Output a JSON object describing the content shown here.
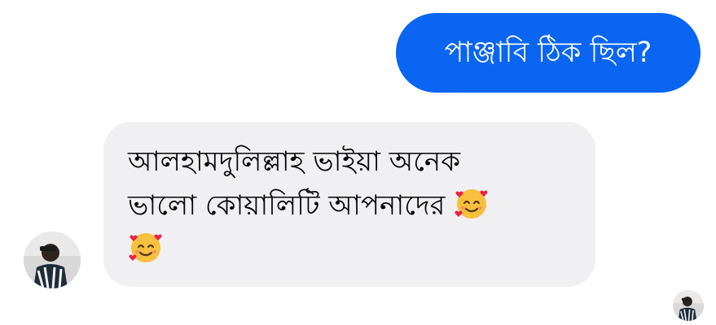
{
  "conversation": {
    "outgoing_message": "পাঞ্জাবি ঠিক ছিল?",
    "incoming_message": {
      "line1": "আলহামদুলিল্লাহ ভাইয়া অনেক",
      "line2": "ভালো কোয়ালিটি আপনাদের",
      "emoji": "smiling-face-with-hearts"
    }
  },
  "colors": {
    "outgoing_bubble": "#0a66f2",
    "incoming_bubble": "#f0f0f3",
    "outgoing_text": "#ffffff",
    "incoming_text": "#050505"
  }
}
